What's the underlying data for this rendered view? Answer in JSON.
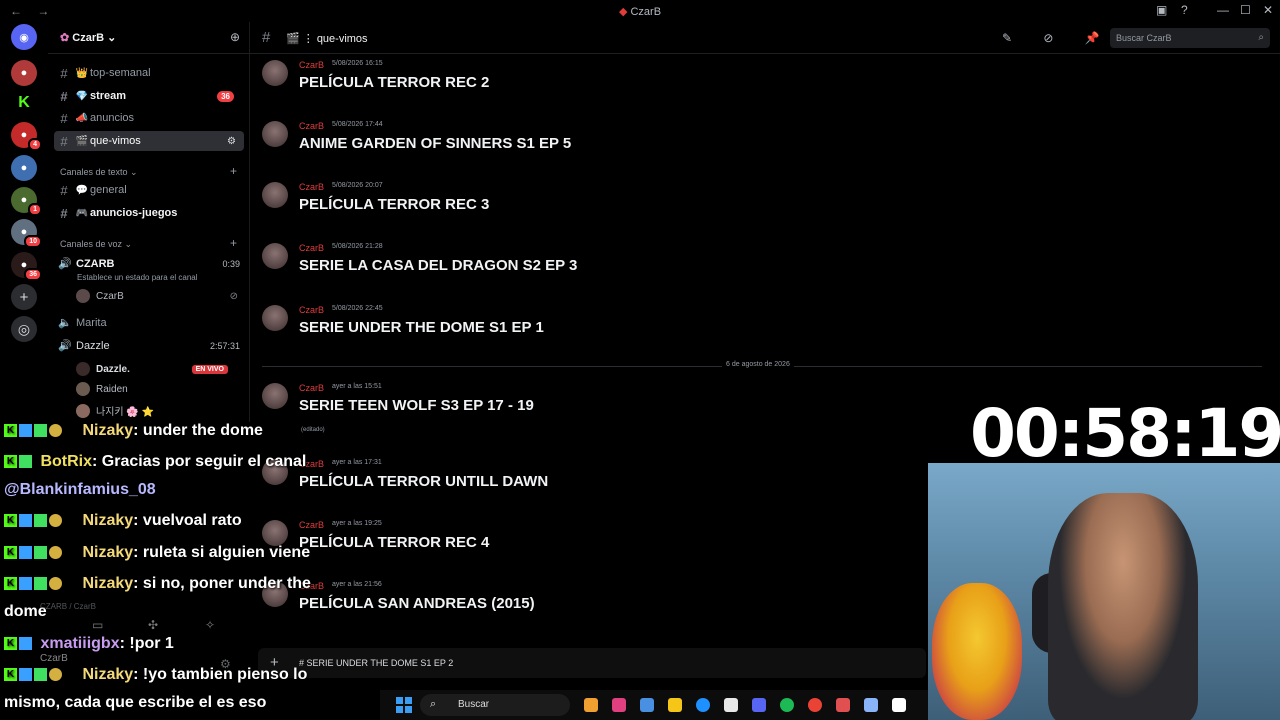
{
  "window": {
    "title": "CzarB",
    "nav": "← →",
    "controls": [
      "▣",
      "?",
      "—",
      "☐",
      "✕"
    ]
  },
  "rail": {
    "servers": [
      {
        "icon": "discord-icon",
        "glyph": "◉",
        "badge": ""
      },
      {
        "icon": "server-car-icon",
        "glyph": "●",
        "badge": ""
      },
      {
        "icon": "server-kick-icon",
        "glyph": "K",
        "badge": ""
      },
      {
        "icon": "server-red-icon",
        "glyph": "●",
        "badge": "4"
      },
      {
        "icon": "server-penguin-icon",
        "glyph": "●",
        "badge": ""
      },
      {
        "icon": "server-circle-icon",
        "glyph": "●",
        "badge": "1"
      },
      {
        "icon": "server-avatar-icon",
        "glyph": "●",
        "badge": "10"
      },
      {
        "icon": "server-czarb-icon",
        "glyph": "●",
        "badge": "36"
      },
      {
        "icon": "add-server-icon",
        "glyph": "+",
        "badge": ""
      },
      {
        "icon": "discover-icon",
        "glyph": "◎",
        "badge": ""
      }
    ]
  },
  "sidebar": {
    "server_name": "CzarB",
    "channels": [
      {
        "name": "top-semanal",
        "emoji": "👑",
        "badge": "",
        "active": false,
        "bold": false
      },
      {
        "name": "stream",
        "emoji": "💎",
        "badge": "36",
        "active": false,
        "bold": true
      },
      {
        "name": "anuncios",
        "emoji": "📣",
        "badge": "",
        "active": false,
        "bold": false
      },
      {
        "name": "que-vimos",
        "emoji": "🎬",
        "badge": "",
        "active": true,
        "bold": false
      }
    ],
    "category_text": "Canales de texto",
    "text_channels": [
      {
        "name": "general",
        "emoji": "💬"
      },
      {
        "name": "anuncios-juegos",
        "emoji": "🎮"
      }
    ],
    "category_voice": "Canales de voz",
    "voice": [
      {
        "name": "CZARB",
        "time": "0:39",
        "status": "Establece un estado para el canal"
      },
      {
        "name": "Marita",
        "time": ""
      },
      {
        "name": "Dazzle",
        "time": "2:57:31"
      }
    ],
    "voice_users_czarb": [
      "CzarB"
    ],
    "voice_users_dazzle": [
      {
        "name": "Dazzle.",
        "live": "EN VIVO"
      },
      {
        "name": "Raiden",
        "live": ""
      },
      {
        "name": "나지키 🌸 ⭐",
        "live": ""
      }
    ]
  },
  "header": {
    "channel": "que-vimos",
    "icons": "✎ ⊘ 📌 👥",
    "search_placeholder": "Buscar CzarB"
  },
  "messages": [
    {
      "author": "CzarB",
      "time": "5/08/2026 16:15",
      "text": "PELÍCULA TERROR REC 2",
      "edited": ""
    },
    {
      "author": "CzarB",
      "time": "5/08/2026 17:44",
      "text": "ANIME GARDEN OF SINNERS S1 EP 5",
      "edited": ""
    },
    {
      "author": "CzarB",
      "time": "5/08/2026 20:07",
      "text": "PELÍCULA TERROR REC 3",
      "edited": ""
    },
    {
      "author": "CzarB",
      "time": "5/08/2026 21:28",
      "text": "SERIE LA CASA DEL DRAGON S2 EP 3",
      "edited": ""
    },
    {
      "author": "CzarB",
      "time": "5/08/2026 22:45",
      "text": "SERIE UNDER THE DOME S1 EP 1",
      "edited": ""
    },
    {
      "author": "CzarB",
      "time": "ayer a las 15:51",
      "text": "SERIE TEEN WOLF S3 EP 17 - 19",
      "edited": "(editado)"
    },
    {
      "author": "CzarB",
      "time": "ayer a las 17:31",
      "text": "PELÍCULA TERROR UNTILL DAWN",
      "edited": ""
    },
    {
      "author": "CzarB",
      "time": "ayer a las 19:25",
      "text": "PELÍCULA TERROR REC 4",
      "edited": ""
    },
    {
      "author": "CzarB",
      "time": "ayer a las 21:56",
      "text": "PELÍCULA SAN ANDREAS (2015)",
      "edited": ""
    }
  ],
  "date_divider": "6 de agosto de 2026",
  "composer": {
    "value": "# SERIE UNDER THE DOME S1 EP 2"
  },
  "timer": "00:58:19",
  "overlay_chat": [
    {
      "user": "Nizaky",
      "msg": ": under the dome",
      "mention": ""
    },
    {
      "user": "BotRix",
      "msg": ": Gracias por seguir el canal",
      "mention": "@Blankinfamius_08"
    },
    {
      "user": "Nizaky",
      "msg": ": vuelvoal rato",
      "mention": ""
    },
    {
      "user": "Nizaky",
      "msg": ": ruleta si alguien viene",
      "mention": ""
    },
    {
      "user": "Nizaky",
      "msg": ": si no, poner under the",
      "mention": "dome"
    },
    {
      "user": "xmatiiigbx",
      "msg": ": !por 1",
      "mention": ""
    },
    {
      "user": "Nizaky",
      "msg": ": !yo tambien pienso lo",
      "mention": "mismo, cada que escribe el es eso"
    }
  ],
  "taskbar": {
    "search_label": "Buscar",
    "colors": [
      "#f0a030",
      "#e04080",
      "#4a90e2",
      "#f5c518",
      "#1e90ff",
      "#e8e8e8",
      "#5865f2",
      "#1db954",
      "#ea4335",
      "#e05050",
      "#8ab4f8",
      "#ffffff"
    ]
  },
  "user_panel": {
    "name": "CzarB",
    "path": "CZARB / CzarB"
  }
}
